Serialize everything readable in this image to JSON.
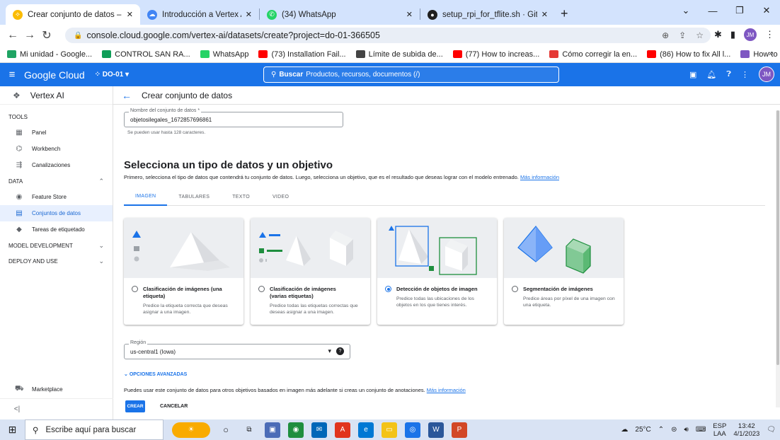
{
  "browser": {
    "tabs": [
      {
        "title": "Crear conjunto de datos – Vertex",
        "active": true,
        "favicon_color": "#fbbc04"
      },
      {
        "title": "Introducción a Vertex AI | Vertex",
        "active": false,
        "favicon_color": "#4285f4"
      },
      {
        "title": "(34) WhatsApp",
        "active": false,
        "favicon_color": "#25d366"
      },
      {
        "title": "setup_rpi_for_tflite.sh · GitHub",
        "active": false,
        "favicon_color": "#1f1f1f"
      }
    ],
    "url": "console.cloud.google.com/vertex-ai/datasets/create?project=do-01-366505",
    "bookmarks": [
      {
        "label": "Mi unidad - Google...",
        "color": "#1fa463"
      },
      {
        "label": "CONTROL SAN RA...",
        "color": "#0f9d58"
      },
      {
        "label": "WhatsApp",
        "color": "#25d366"
      },
      {
        "label": "(73) Installation Fail...",
        "color": "#ff0000"
      },
      {
        "label": "Límite de subida de...",
        "color": "#444444"
      },
      {
        "label": "(77) How to increas...",
        "color": "#ff0000"
      },
      {
        "label": "Cómo corregir la en...",
        "color": "#e53935"
      },
      {
        "label": "(86) How to fix All l...",
        "color": "#ff0000"
      },
      {
        "label": "How to Create a CS...",
        "color": "#7e57c2"
      }
    ],
    "bookmarks_more": "»"
  },
  "gcp": {
    "brand": "Google Cloud",
    "project": "DO-01",
    "search_label": "Buscar",
    "search_placeholder": "Productos, recursos, documentos (/)",
    "avatar": "JM",
    "accent": "#1a73e8"
  },
  "sidebar": {
    "product": "Vertex AI",
    "sections": [
      {
        "label": "TOOLS",
        "items": [
          {
            "label": "Panel",
            "icon": "dashboard-icon"
          },
          {
            "label": "Workbench",
            "icon": "workbench-icon"
          },
          {
            "label": "Canalizaciones",
            "icon": "pipelines-icon"
          }
        ]
      },
      {
        "label": "DATA",
        "items": [
          {
            "label": "Feature Store",
            "icon": "feature-store-icon"
          },
          {
            "label": "Conjuntos de datos",
            "icon": "datasets-icon",
            "selected": true
          },
          {
            "label": "Tareas de etiquetado",
            "icon": "labeling-icon"
          }
        ]
      },
      {
        "label": "MODEL DEVELOPMENT"
      },
      {
        "label": "DEPLOY AND USE"
      }
    ],
    "marketplace": "Marketplace",
    "collapse": "<|"
  },
  "page": {
    "title": "Crear conjunto de datos",
    "name_field": {
      "label": "Nombre del conjunto de datos *",
      "value": "objetosilegales_1672857696861",
      "hint": "Se pueden usar hasta 128 caracteres."
    },
    "heading": "Selecciona un tipo de datos y un objetivo",
    "description": "Primero, selecciona el tipo de datos que contendrá tu conjunto de datos. Luego, selecciona un objetivo, que es el resultado que deseas lograr con el modelo entrenado.",
    "more_info": "Más información",
    "tabs": [
      "IMAGEN",
      "TABULARES",
      "TEXTO",
      "VIDEO"
    ],
    "active_tab": 0,
    "objectives": [
      {
        "title": "Clasificación de imágenes (una etiqueta)",
        "desc": "Predice la etiqueta correcta que deseas asignar a una imagen.",
        "selected": false
      },
      {
        "title": "Clasificación de imágenes (varias etiquetas)",
        "desc": "Predice todas las etiquetas correctas que deseas asignar a una imagen.",
        "selected": false
      },
      {
        "title": "Detección de objetos de imagen",
        "desc": "Predice todas las ubicaciones de los objetos en los que tienes interés.",
        "selected": true
      },
      {
        "title": "Segmentación de imágenes",
        "desc": "Predice áreas por píxel de una imagen con una etiqueta.",
        "selected": false
      }
    ],
    "region": {
      "label": "Región",
      "value": "us-central1 (Iowa)"
    },
    "advanced": "OPCIONES AVANZADAS",
    "note": "Puedes usar este conjunto de datos para otros objetivos basados en imagen más adelante si creas un conjunto de anotaciones.",
    "note_link": "Más información",
    "create_button": "CREAR",
    "cancel_button": "CANCELAR"
  },
  "taskbar": {
    "search_placeholder": "Escribe aquí para buscar",
    "weather": "25°C",
    "lang": "ESP",
    "lang2": "LAA",
    "time": "13:42",
    "date": "4/1/2023"
  }
}
